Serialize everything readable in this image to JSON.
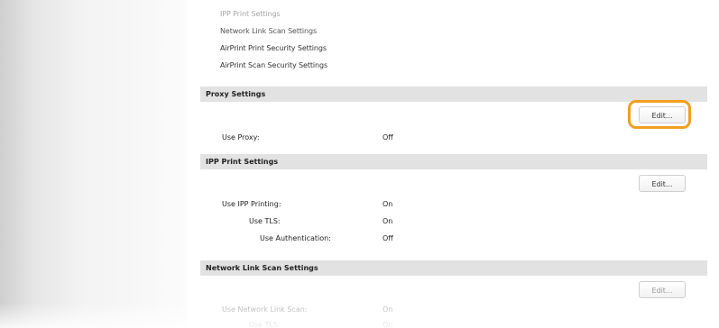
{
  "links": [
    "IPP Print Settings",
    "Network Link Scan Settings",
    "AirPrint Print Security Settings",
    "AirPrint Scan Security Settings"
  ],
  "proxy": {
    "header": "Proxy Settings",
    "edit_label": "Edit...",
    "use_proxy_label": "Use Proxy:",
    "use_proxy_value": "Off"
  },
  "ipp": {
    "header": "IPP Print Settings",
    "edit_label": "Edit...",
    "use_ipp_label": "Use IPP Printing:",
    "use_ipp_value": "On",
    "use_tls_label": "Use TLS:",
    "use_tls_value": "On",
    "use_auth_label": "Use Authentication:",
    "use_auth_value": "Off"
  },
  "network_link_scan": {
    "header": "Network Link Scan Settings",
    "edit_label": "Edit...",
    "use_nls_label": "Use Network Link Scan:",
    "use_nls_value": "On",
    "use_tls_label": "Use TLS:",
    "use_tls_value": "On"
  },
  "colors": {
    "highlight": "#f0a020",
    "header_bg": "#e2e2e2"
  }
}
